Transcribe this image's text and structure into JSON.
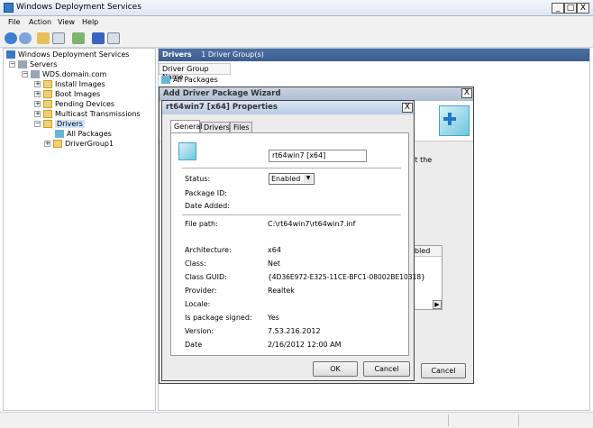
{
  "app_title": "Windows Deployment Services",
  "window_buttons": {
    "minimize": "_",
    "maximize": "□",
    "close": "X"
  },
  "menu": [
    "File",
    "Action",
    "View",
    "Help"
  ],
  "tree": {
    "root": "Windows Deployment Services",
    "servers": "Servers",
    "server": "WDS.domain.com",
    "install": "Install Images",
    "boot": "Boot Images",
    "pending": "Pending Devices",
    "multicast": "Multicast Transmissions",
    "drivers": "Drivers",
    "all_packages": "All Packages",
    "group1": "DriverGroup1",
    "plus": "+",
    "minus": "−"
  },
  "right": {
    "header_title": "Drivers",
    "header_count": "1 Driver Group(s)",
    "col": "Driver Group Name",
    "row": "All Packages"
  },
  "wizard": {
    "title": "Add Driver Package Wizard",
    "close": "X",
    "side_text_1": "ct the",
    "col_frag": "bled",
    "arrow": "▶",
    "cancel": "Cancel"
  },
  "props": {
    "title": "rt64win7 [x64] Properties",
    "close": "X",
    "tabs": [
      "General",
      "Drivers",
      "Files"
    ],
    "name": "rt64win7 [x64]",
    "status_label": "Status:",
    "status_value": "Enabled",
    "dropdown_arrow": "▼",
    "fields_a": [
      [
        "Package ID:",
        ""
      ],
      [
        "Date Added:",
        ""
      ]
    ],
    "file_path_label": "File path:",
    "file_path": "C:\\rt64win7\\rt64win7.inf",
    "fields_b": [
      [
        "Architecture:",
        "x64"
      ],
      [
        "Class:",
        "Net"
      ],
      [
        "Class GUID:",
        "{4D36E972-E325-11CE-BFC1-08002BE10318}"
      ],
      [
        "Provider:",
        "Realtek"
      ],
      [
        "Locale:",
        ""
      ],
      [
        "Is package signed:",
        "Yes"
      ],
      [
        "Version:",
        "7.53.216.2012"
      ],
      [
        "Date",
        "2/16/2012 12:00 AM"
      ]
    ],
    "ok": "OK",
    "cancel": "Cancel"
  },
  "colors": {
    "header": "#3d5d8c",
    "dialog_bg": "#ececec",
    "title_grad": "#aebdd1"
  }
}
